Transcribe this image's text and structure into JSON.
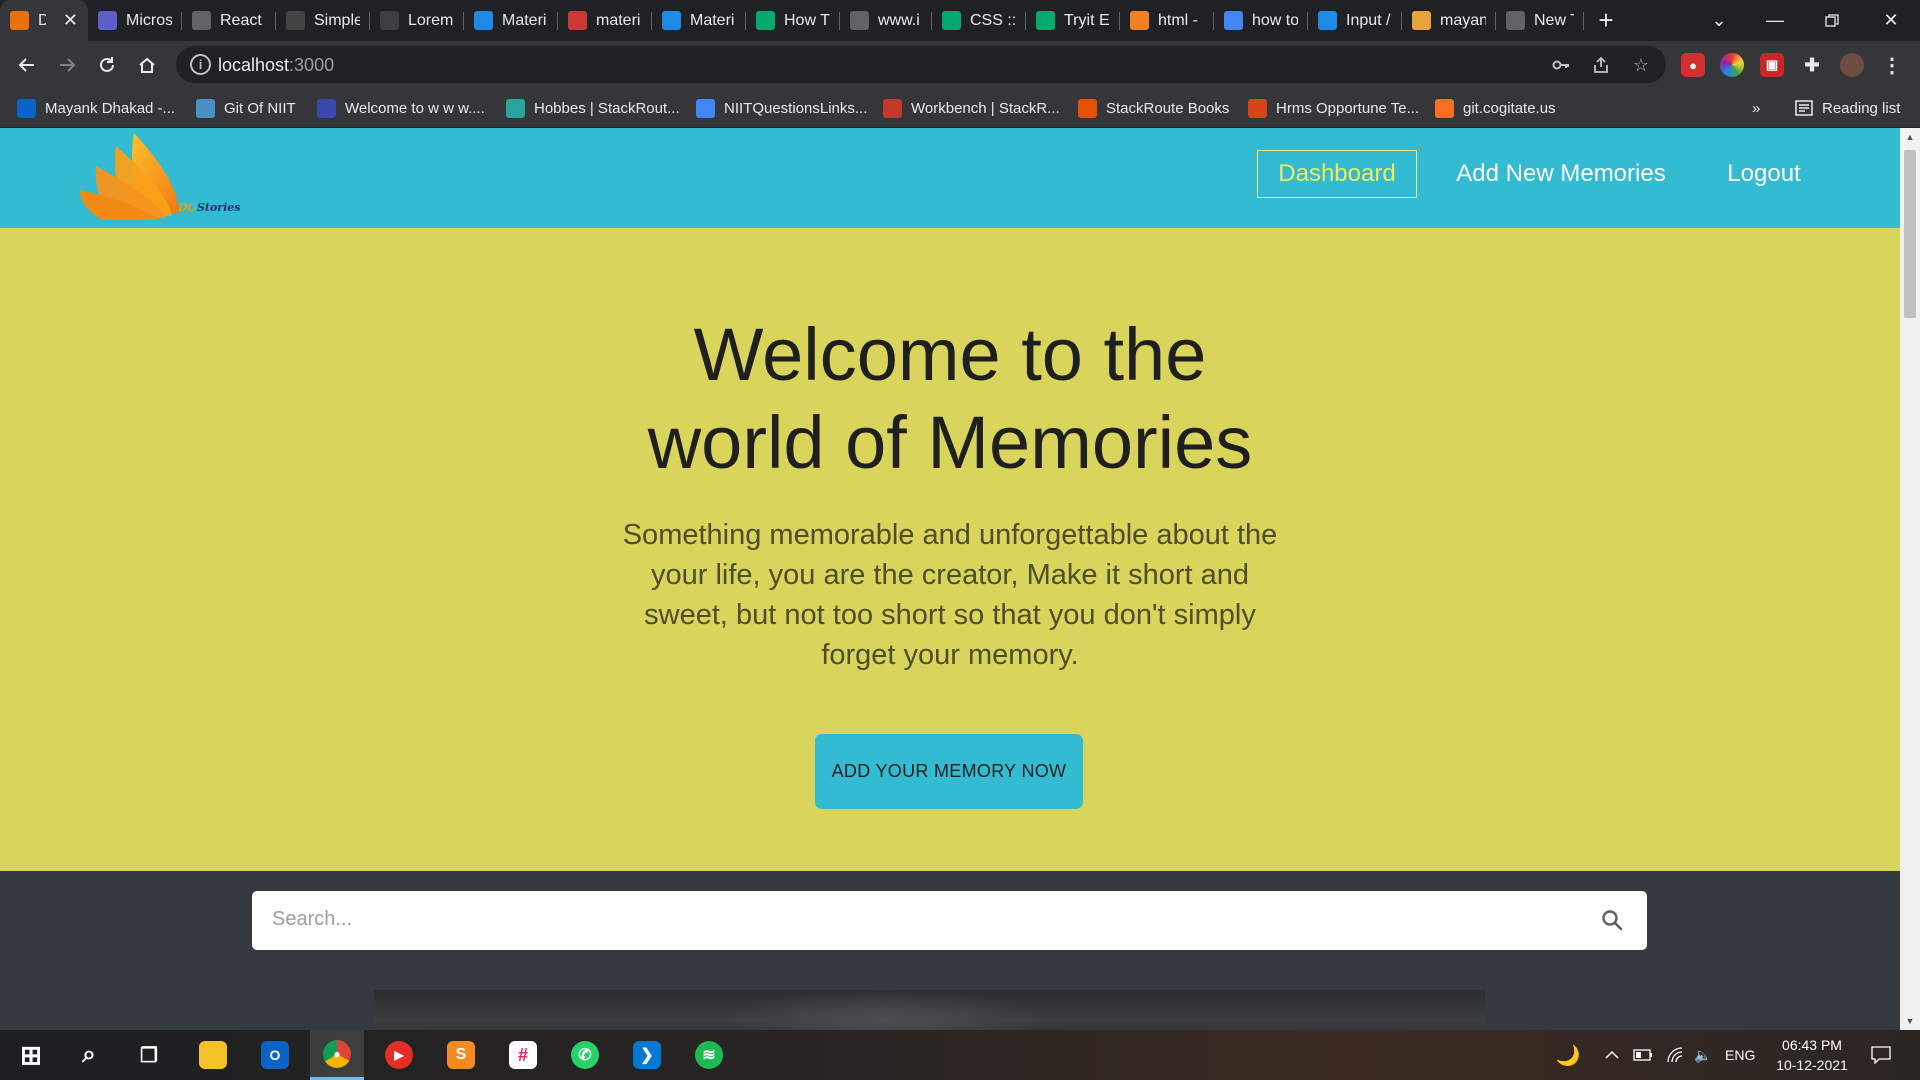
{
  "browser": {
    "tabs": [
      {
        "title": "Dg",
        "icon": "gitlab-fox-icon",
        "color": "#e8710a"
      },
      {
        "title": "Micros",
        "icon": "teams-icon",
        "color": "#5b5fc7"
      },
      {
        "title": "React",
        "icon": "react-doc-icon",
        "color": "#5f6368"
      },
      {
        "title": "Simple",
        "icon": "codepen-icon",
        "color": "#444444"
      },
      {
        "title": "Lorem",
        "icon": "lorem-icon",
        "color": "#3c4043"
      },
      {
        "title": "Materi",
        "icon": "mui-icon",
        "color": "#1e88e5"
      },
      {
        "title": "materi",
        "icon": "npm-icon",
        "color": "#cb3837"
      },
      {
        "title": "Materi",
        "icon": "mui-icon",
        "color": "#1e88e5"
      },
      {
        "title": "How T",
        "icon": "w3schools-icon",
        "color": "#04aa6d"
      },
      {
        "title": "www.i",
        "icon": "globe-icon",
        "color": "#5f6368"
      },
      {
        "title": "CSS ::p",
        "icon": "w3schools-icon",
        "color": "#04aa6d"
      },
      {
        "title": "Tryit E",
        "icon": "w3schools-icon",
        "color": "#04aa6d"
      },
      {
        "title": "html -",
        "icon": "stackoverflow-icon",
        "color": "#f48024"
      },
      {
        "title": "how to",
        "icon": "google-icon",
        "color": "#4285f4"
      },
      {
        "title": "Input /",
        "icon": "mui-icon",
        "color": "#1e88e5"
      },
      {
        "title": "mayan",
        "icon": "document-icon",
        "color": "#e8a33b"
      },
      {
        "title": "New T",
        "icon": "chrome-icon",
        "color": "#5f6368"
      }
    ],
    "address": {
      "host": "localhost",
      "port": ":3000"
    },
    "bookmarks": [
      {
        "label": "Mayank Dhakad -...",
        "icon": "outlook-icon",
        "color": "#0a64c8"
      },
      {
        "label": "Git Of NIIT",
        "icon": "git-icon",
        "color": "#4a90c2"
      },
      {
        "label": "Welcome to w w w....",
        "icon": "columns-icon",
        "color": "#3949ab"
      },
      {
        "label": "Hobbes | StackRout...",
        "icon": "hobbes-icon",
        "color": "#26a69a"
      },
      {
        "label": "NIITQuestionsLinks...",
        "icon": "docs-icon",
        "color": "#4285f4"
      },
      {
        "label": "Workbench | StackR...",
        "icon": "workbench-icon",
        "color": "#c0392b"
      },
      {
        "label": "StackRoute Books",
        "icon": "book-icon",
        "color": "#e65100"
      },
      {
        "label": "Hrms Opportune Te...",
        "icon": "hrms-icon",
        "color": "#d84315"
      },
      {
        "label": "git.cogitate.us",
        "icon": "gitlab-fox-icon",
        "color": "#fc6d26"
      }
    ],
    "reading_list": "Reading list",
    "overflow": "»"
  },
  "app": {
    "logo_text": {
      "dg": "DG",
      "rest": "Stories"
    },
    "nav": {
      "dashboard": "Dashboard",
      "add_new": "Add New Memories",
      "logout": "Logout"
    },
    "hero": {
      "title_line1": "Welcome to the",
      "title_line2": "world of Memories",
      "subtitle": "Something memorable and unforgettable about the your life, you are the creator, Make it short and sweet, but not too short so that you don't simply forget your memory.",
      "cta": "ADD YOUR MEMORY NOW"
    },
    "search": {
      "placeholder": "Search..."
    },
    "colors": {
      "navbar": "#33bbd1",
      "hero": "#d9d45b",
      "body": "#343a40",
      "active_nav": "#f1ec57"
    }
  },
  "taskbar": {
    "apps": [
      {
        "name": "windows-start-icon"
      },
      {
        "name": "search-icon"
      },
      {
        "name": "task-view-icon"
      },
      {
        "name": "file-explorer-icon"
      },
      {
        "name": "outlook-icon"
      },
      {
        "name": "chrome-icon"
      },
      {
        "name": "youtube-music-icon"
      },
      {
        "name": "sublime-text-icon"
      },
      {
        "name": "slack-icon"
      },
      {
        "name": "whatsapp-icon"
      },
      {
        "name": "vscode-icon"
      },
      {
        "name": "spotify-icon"
      }
    ],
    "language": "ENG",
    "time": "06:43 PM",
    "date": "10-12-2021"
  }
}
